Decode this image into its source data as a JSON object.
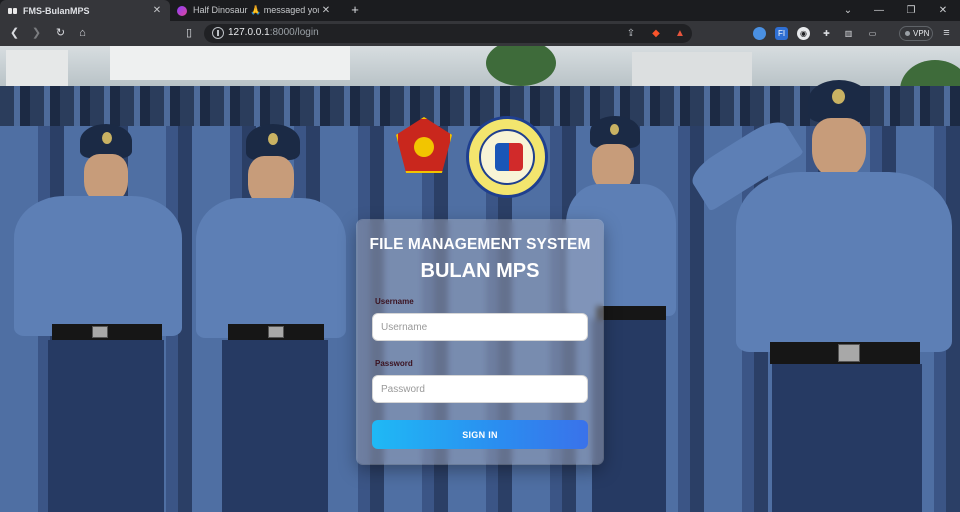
{
  "browser": {
    "tabs": [
      {
        "title": "FMS-BulanMPS",
        "active": true,
        "icon": "fms-icon"
      },
      {
        "title": "Half Dinosaur 🙏 messaged you",
        "active": false,
        "icon": "messenger-icon"
      }
    ],
    "address": {
      "host": "127.0.0.1",
      "path": ":8000/login"
    },
    "vpn_label": "VPN",
    "extension_labels": {
      "fi": "FI"
    },
    "colors": {
      "tab_active": "#35363a",
      "toolbar": "#35363a",
      "omnibox": "#202124"
    }
  },
  "login": {
    "title_line1": "FILE MANAGEMENT SYSTEM",
    "title_line2": "BULAN MPS",
    "username_label": "Username",
    "username_placeholder": "Username",
    "username_value": "",
    "password_label": "Password",
    "password_placeholder": "Password",
    "password_value": "",
    "signin_label": "SIGN IN",
    "colors": {
      "button_start": "#1fb9f5",
      "button_end": "#3a72ea",
      "label": "#3b1320"
    }
  },
  "logos": [
    "pnp-seal",
    "bulan-municipal-police-station-seal"
  ]
}
